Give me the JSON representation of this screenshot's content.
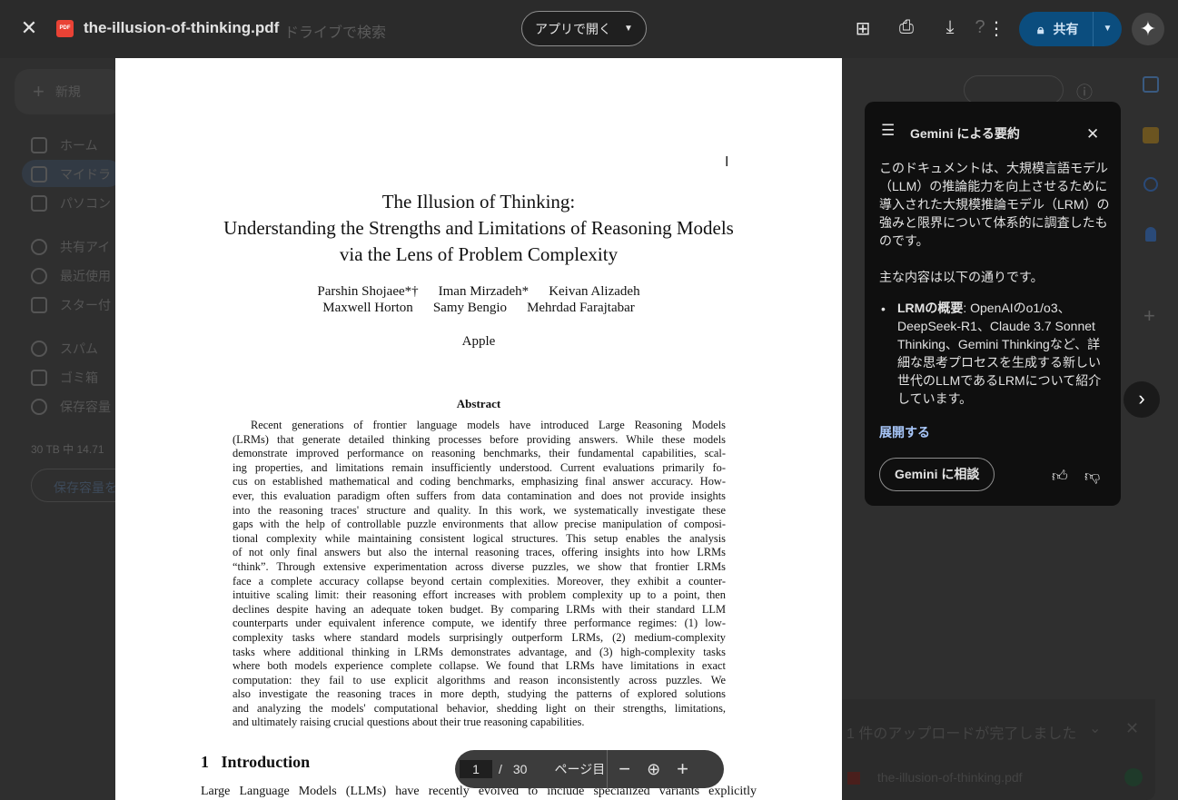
{
  "topbar": {
    "filename": "the-illusion-of-thinking.pdf",
    "pdf_badge": "PDF",
    "search_placeholder": "ドライブで検索",
    "open_with": "アプリで開く",
    "share": "共有"
  },
  "sidebar": {
    "new": "新規",
    "items": [
      "ホーム",
      "マイドラ",
      "パソコン",
      "共有アイ",
      "最近使用",
      "スター付",
      "スパム",
      "ゴミ箱",
      "保存容量"
    ],
    "storage": "30 TB 中 14.71",
    "storage_button": "保存容量を"
  },
  "pdf": {
    "title": [
      "The Illusion of Thinking:",
      "Understanding the Strengths and Limitations of Reasoning Models",
      "via the Lens of Problem Complexity"
    ],
    "authors": [
      [
        "Parshin Shojaee*†",
        "Iman Mirzadeh*",
        "Keivan Alizadeh"
      ],
      [
        "Maxwell Horton",
        "Samy Bengio",
        "Mehrdad Farajtabar"
      ]
    ],
    "affiliation": "Apple",
    "abstract_heading": "Abstract",
    "abstract_lines": [
      "Recent generations of frontier language models have introduced Large Reasoning Models",
      "(LRMs) that generate detailed thinking processes before providing answers. While these models",
      "demonstrate improved performance on reasoning benchmarks, their fundamental capabilities, scal-",
      "ing properties, and limitations remain insufficiently understood. Current evaluations primarily fo-",
      "cus on established mathematical and coding benchmarks, emphasizing final answer accuracy. How-",
      "ever, this evaluation paradigm often suffers from data contamination and does not provide insights",
      "into the reasoning traces' structure and quality. In this work, we systematically investigate these",
      "gaps with the help of controllable puzzle environments that allow precise manipulation of composi-",
      "tional complexity while maintaining consistent logical structures. This setup enables the analysis",
      "of not only final answers but also the internal reasoning traces, offering insights into how LRMs",
      "“think”. Through extensive experimentation across diverse puzzles, we show that frontier LRMs",
      "face a complete accuracy collapse beyond certain complexities. Moreover, they exhibit a counter-",
      "intuitive scaling limit: their reasoning effort increases with problem complexity up to a point, then",
      "declines despite having an adequate token budget. By comparing LRMs with their standard LLM",
      "counterparts under equivalent inference compute, we identify three performance regimes: (1) low-",
      "complexity tasks where standard models surprisingly outperform LRMs, (2) medium-complexity",
      "tasks where additional thinking in LRMs demonstrates advantage, and (3) high-complexity tasks",
      "where both models experience complete collapse. We found that LRMs have limitations in exact",
      "computation: they fail to use explicit algorithms and reason inconsistently across puzzles. We",
      "also investigate the reasoning traces in more depth, studying the patterns of explored solutions",
      "and analyzing the models' computational behavior, shedding light on their strengths, limitations,",
      "and ultimately raising crucial questions about their true reasoning capabilities."
    ],
    "section_number": "1",
    "section_title": "Introduction",
    "intro_line": "Large Language Models (LLMs) have recently evolved to include specialized variants explicitly"
  },
  "toolbar": {
    "page": "1",
    "separator": "/",
    "total": "30",
    "page_label": "ページ目"
  },
  "gemini": {
    "title": "Gemini による要約",
    "p1": "このドキュメントは、大規模言語モデル（LLM）の推論能力を向上させるために導入された大規模推論モデル（LRM）の強みと限界について体系的に調査したものです。",
    "p2": "主な内容は以下の通りです。",
    "bullet_bold": "LRMの概要",
    "bullet_text": ": OpenAIのo1/o3、DeepSeek-R1、Claude 3.7 Sonnet Thinking、Gemini Thinkingなど、詳細な思考プロセスを生成する新しい世代のLLMであるLRMについて紹介しています。",
    "expand": "展開する",
    "ask": "Gemini に相談"
  },
  "upload": {
    "title": "1 件のアップロードが完了しました",
    "file": "the-illusion-of-thinking.pdf"
  },
  "colors": {
    "share": "#0b4d7e",
    "pdf_red": "#e94235",
    "panel": "#0f0f0f"
  }
}
